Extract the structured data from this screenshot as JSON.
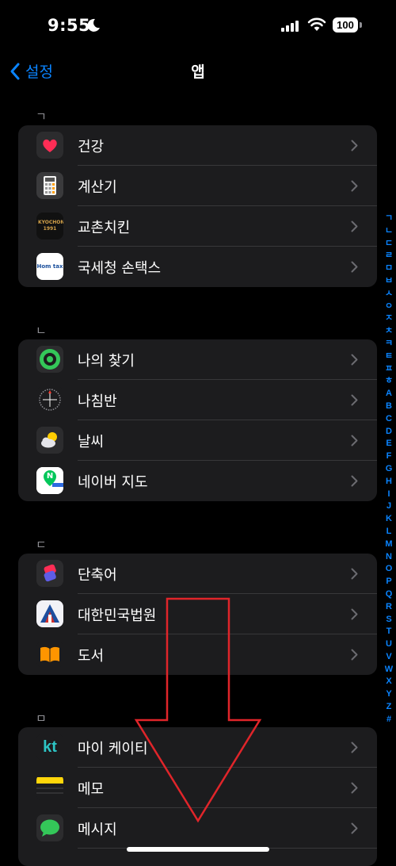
{
  "status_bar": {
    "time": "9:55",
    "battery": "100"
  },
  "nav": {
    "back_label": "설정",
    "title": "앱"
  },
  "sections": [
    {
      "header": "ㄱ",
      "items": [
        {
          "label": "건강",
          "icon": "health-icon"
        },
        {
          "label": "계산기",
          "icon": "calculator-icon"
        },
        {
          "label": "교촌치킨",
          "icon": "kyochon-icon",
          "icon_text": "KYOCHON 1991"
        },
        {
          "label": "국세청 손택스",
          "icon": "hometax-icon",
          "icon_text": "Hom tax"
        }
      ]
    },
    {
      "header": "ㄴ",
      "items": [
        {
          "label": "나의 찾기",
          "icon": "findmy-icon"
        },
        {
          "label": "나침반",
          "icon": "compass-icon"
        },
        {
          "label": "날씨",
          "icon": "weather-icon"
        },
        {
          "label": "네이버 지도",
          "icon": "naver-map-icon",
          "icon_text": "N"
        }
      ]
    },
    {
      "header": "ㄷ",
      "items": [
        {
          "label": "단축어",
          "icon": "shortcuts-icon"
        },
        {
          "label": "대한민국법원",
          "icon": "court-icon"
        },
        {
          "label": "도서",
          "icon": "books-icon"
        }
      ]
    },
    {
      "header": "ㅁ",
      "items": [
        {
          "label": "마이 케이티",
          "icon": "kt-icon",
          "icon_text": "kt"
        },
        {
          "label": "메모",
          "icon": "notes-icon"
        },
        {
          "label": "메시지",
          "icon": "messages-icon"
        }
      ]
    }
  ],
  "index": [
    "ㄱ",
    "ㄴ",
    "ㄷ",
    "ㄹ",
    "ㅁ",
    "ㅂ",
    "ㅅ",
    "ㅇ",
    "ㅈ",
    "ㅊ",
    "ㅋ",
    "ㅌ",
    "ㅍ",
    "ㅎ",
    "A",
    "B",
    "C",
    "D",
    "E",
    "F",
    "G",
    "H",
    "I",
    "J",
    "K",
    "L",
    "M",
    "N",
    "O",
    "P",
    "Q",
    "R",
    "S",
    "T",
    "U",
    "V",
    "W",
    "X",
    "Y",
    "Z",
    "#"
  ],
  "colors": {
    "accent": "#0a84ff",
    "group_bg": "#1c1c1e",
    "arrow": "#e0252a"
  }
}
